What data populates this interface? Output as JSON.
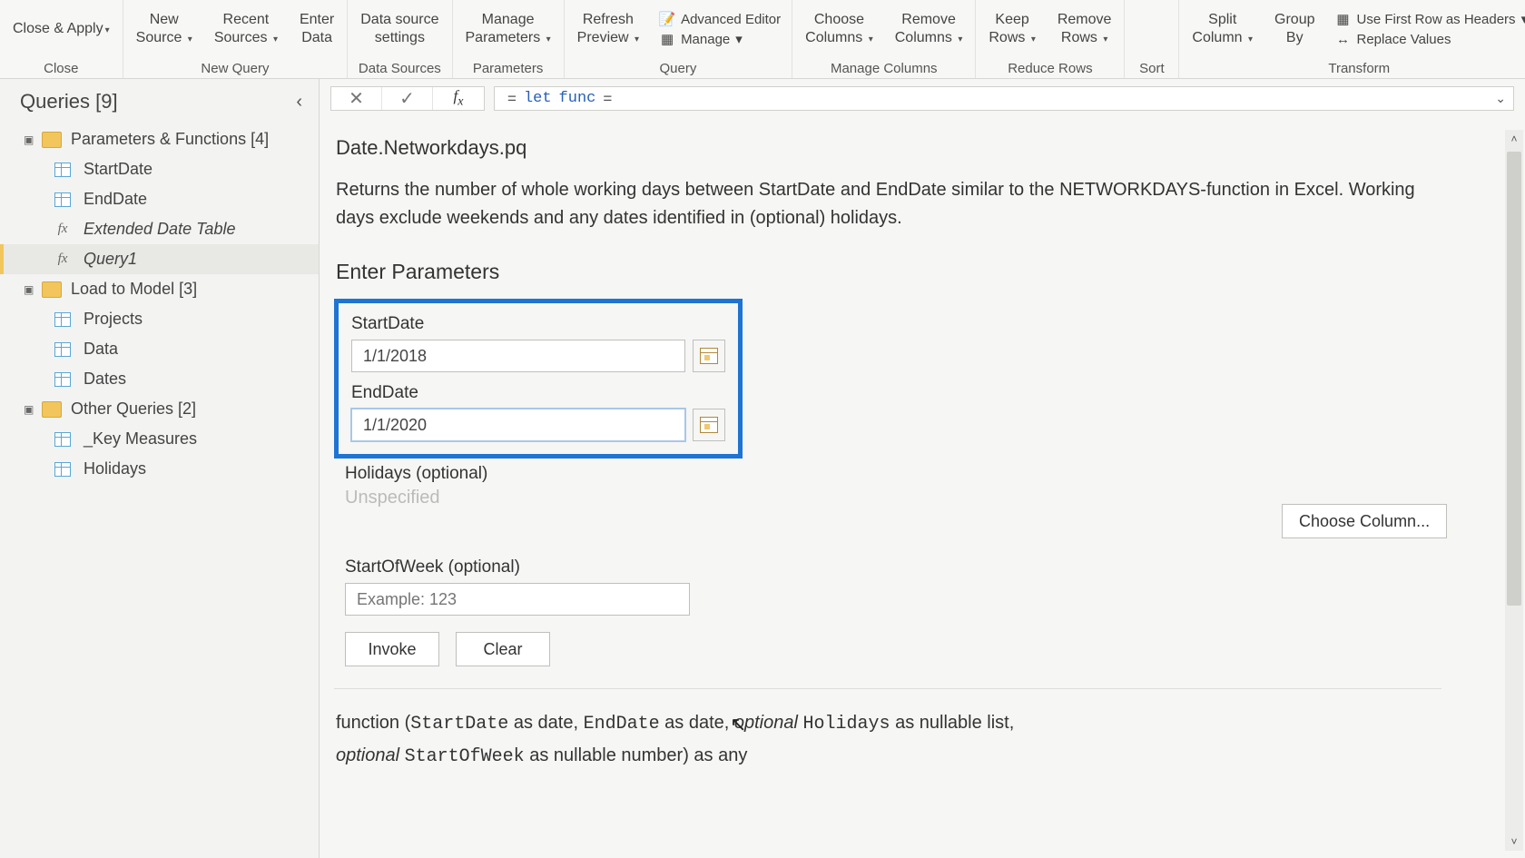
{
  "ribbon": {
    "groups": {
      "close": {
        "label": "Close",
        "items": [
          "Close & Apply"
        ]
      },
      "newquery": {
        "label": "New Query",
        "items": [
          "New Source",
          "Recent Sources",
          "Enter Data"
        ]
      },
      "datasources": {
        "label": "Data Sources",
        "items": [
          "Data source settings"
        ]
      },
      "parameters": {
        "label": "Parameters",
        "items": [
          "Manage Parameters"
        ]
      },
      "query": {
        "label": "Query",
        "items": [
          "Refresh Preview"
        ],
        "stack": [
          "Advanced Editor",
          "Manage"
        ]
      },
      "managecols": {
        "label": "Manage Columns",
        "items": [
          "Choose Columns",
          "Remove Columns"
        ]
      },
      "reducerows": {
        "label": "Reduce Rows",
        "items": [
          "Keep Rows",
          "Remove Rows"
        ]
      },
      "sort": {
        "label": "Sort"
      },
      "transform": {
        "label": "Transform",
        "items": [
          "Split Column",
          "Group By"
        ],
        "stack": [
          "Use First Row as Headers",
          "Replace Values"
        ]
      }
    }
  },
  "queries": {
    "title": "Queries [9]",
    "groups": [
      {
        "name": "Parameters & Functions [4]",
        "items": [
          {
            "label": "StartDate",
            "kind": "tbl"
          },
          {
            "label": "EndDate",
            "kind": "tbl"
          },
          {
            "label": "Extended Date Table",
            "kind": "fx"
          },
          {
            "label": "Query1",
            "kind": "fx",
            "selected": true
          }
        ]
      },
      {
        "name": "Load to Model [3]",
        "items": [
          {
            "label": "Projects",
            "kind": "tbl"
          },
          {
            "label": "Data",
            "kind": "tbl"
          },
          {
            "label": "Dates",
            "kind": "tbl"
          }
        ]
      },
      {
        "name": "Other Queries [2]",
        "items": [
          {
            "label": "_Key Measures",
            "kind": "tbl"
          },
          {
            "label": "Holidays",
            "kind": "tbl"
          }
        ]
      }
    ]
  },
  "formula": {
    "prefix": "=",
    "kw1": "let",
    "kw2": "func",
    "tail": "="
  },
  "doc": {
    "title": "Date.Networkdays.pq",
    "desc": "Returns the number of whole working days between StartDate and EndDate similar to the NETWORKDAYS-function in Excel. Working days exclude weekends and any dates identified in (optional) holidays.",
    "enter_params_title": "Enter Parameters",
    "params": {
      "start_label": "StartDate",
      "start_value": "1/1/2018",
      "end_label": "EndDate",
      "end_value": "1/1/2020",
      "holidays_label": "Holidays (optional)",
      "holidays_value": "Unspecified",
      "sow_label": "StartOfWeek (optional)",
      "sow_placeholder": "Example: 123"
    },
    "buttons": {
      "invoke": "Invoke",
      "clear": "Clear",
      "choose_col": "Choose Column..."
    }
  },
  "signature": {
    "text_parts": {
      "p1": "function (",
      "p2": "StartDate",
      "p3": " as date, ",
      "p4": "EndDate",
      "p5": " as date, ",
      "p6": "optional",
      "p7": " ",
      "p8": "Holidays",
      "p9": " as nullable list,",
      "p10": "optional",
      "p11": " ",
      "p12": "StartOfWeek",
      "p13": " as nullable number) as any"
    }
  }
}
